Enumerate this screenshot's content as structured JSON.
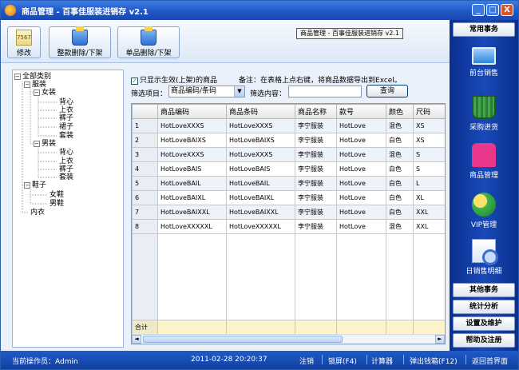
{
  "window": {
    "title": "商品管理 - 百事佳服装进销存 v2.1",
    "min_glyph": "_",
    "max_glyph": "□",
    "close_glyph": "X"
  },
  "toolbar": {
    "edit_icon_text": "7567",
    "edit_label": "修改",
    "bulk_delete_label": "整款删除/下架",
    "single_delete_label": "单品删除/下架",
    "page_badge": "商品管理 - 百事佳服装进销存 v2.1"
  },
  "tree": {
    "root": "全部类别",
    "clothing": "服装",
    "women": "女装",
    "women_items": [
      "背心",
      "上衣",
      "裤子",
      "裙子",
      "套装"
    ],
    "men": "男装",
    "men_items": [
      "背心",
      "上衣",
      "裤子",
      "套装"
    ],
    "shoes": "鞋子",
    "shoes_items": [
      "女鞋",
      "男鞋"
    ],
    "underwear": "内衣"
  },
  "filter": {
    "checkbox_glyph": "✓",
    "only_listed_label": "只显示生效(上架)的商品",
    "note": "备注：在表格上点右键，将商品数据导出到Excel。",
    "field_label": "筛选项目：",
    "field_value": "商品编码/条码",
    "dropdown_glyph": "▼",
    "content_label": "筛选内容：",
    "content_value": "",
    "query_label": "查询"
  },
  "grid": {
    "columns": [
      "",
      "商品编码",
      "商品条码",
      "商品名称",
      "款号",
      "颜色",
      "尺码"
    ],
    "rows": [
      [
        "1",
        "HotLoveXXXS",
        "HotLoveXXXS",
        "李宁服装",
        "HotLove",
        "混色",
        "XS"
      ],
      [
        "2",
        "HotLoveBAIXS",
        "HotLoveBAIXS",
        "李宁服装",
        "HotLove",
        "白色",
        "XS"
      ],
      [
        "3",
        "HotLoveXXXS",
        "HotLoveXXXS",
        "李宁服装",
        "HotLove",
        "混色",
        "S"
      ],
      [
        "4",
        "HotLoveBAIS",
        "HotLoveBAIS",
        "李宁服装",
        "HotLove",
        "白色",
        "S"
      ],
      [
        "5",
        "HotLoveBAIL",
        "HotLoveBAIL",
        "李宁服装",
        "HotLove",
        "白色",
        "L"
      ],
      [
        "6",
        "HotLoveBAIXL",
        "HotLoveBAIXL",
        "李宁服装",
        "HotLove",
        "白色",
        "XL"
      ],
      [
        "7",
        "HotLoveBAIXXL",
        "HotLoveBAIXXL",
        "李宁服装",
        "HotLove",
        "白色",
        "XXL"
      ],
      [
        "8",
        "HotLoveXXXXXL",
        "HotLoveXXXXXL",
        "李宁服装",
        "HotLove",
        "混色",
        "XXL"
      ]
    ],
    "total_label": "合计",
    "scroll_left_glyph": "◄",
    "scroll_right_glyph": "►"
  },
  "sidebar": {
    "common_header": "常用事务",
    "items": [
      {
        "label": "前台销售",
        "icon": "laptop-icon"
      },
      {
        "label": "采购进货",
        "icon": "basket-icon"
      },
      {
        "label": "商品管理",
        "icon": "shirt-icon"
      },
      {
        "label": "VIP管理",
        "icon": "vip-icon"
      },
      {
        "label": "日销售明细",
        "icon": "report-icon"
      }
    ],
    "other_header": "其他事务",
    "stats_header": "统计分析",
    "settings_header": "设置及维护",
    "help_header": "帮助及注册"
  },
  "status": {
    "operator_label": "当前操作员：Admin",
    "datetime": "2011-02-28 20:20:37",
    "logout": "注销",
    "lock": "锁屏(F4)",
    "calculator": "计算器",
    "cash_drawer": "弹出钱箱(F12)",
    "home": "返回首界面"
  }
}
